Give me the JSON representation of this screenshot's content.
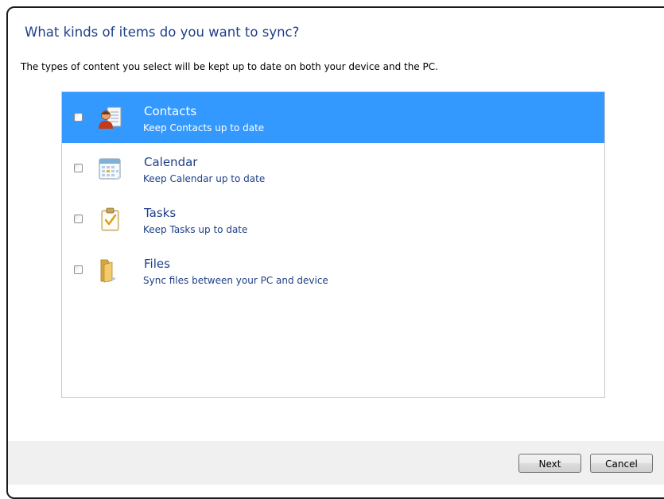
{
  "dialog": {
    "title": "What kinds of items do you want to sync?",
    "subtitle": "The types of content you select will be kept up to date on both your device and the PC."
  },
  "items": [
    {
      "name": "Contacts",
      "description": "Keep Contacts up to date",
      "checked": false,
      "selected": true,
      "icon": "contacts-icon"
    },
    {
      "name": "Calendar",
      "description": "Keep Calendar up to date",
      "checked": false,
      "selected": false,
      "icon": "calendar-icon"
    },
    {
      "name": "Tasks",
      "description": "Keep Tasks up to date",
      "checked": false,
      "selected": false,
      "icon": "tasks-icon"
    },
    {
      "name": "Files",
      "description": "Sync files between your PC and device",
      "checked": false,
      "selected": false,
      "icon": "folder-icon"
    }
  ],
  "buttons": {
    "next": "Next",
    "cancel": "Cancel"
  },
  "colors": {
    "accent": "#3399ff",
    "heading": "#1e3f87",
    "footer": "#f0f0f0"
  }
}
